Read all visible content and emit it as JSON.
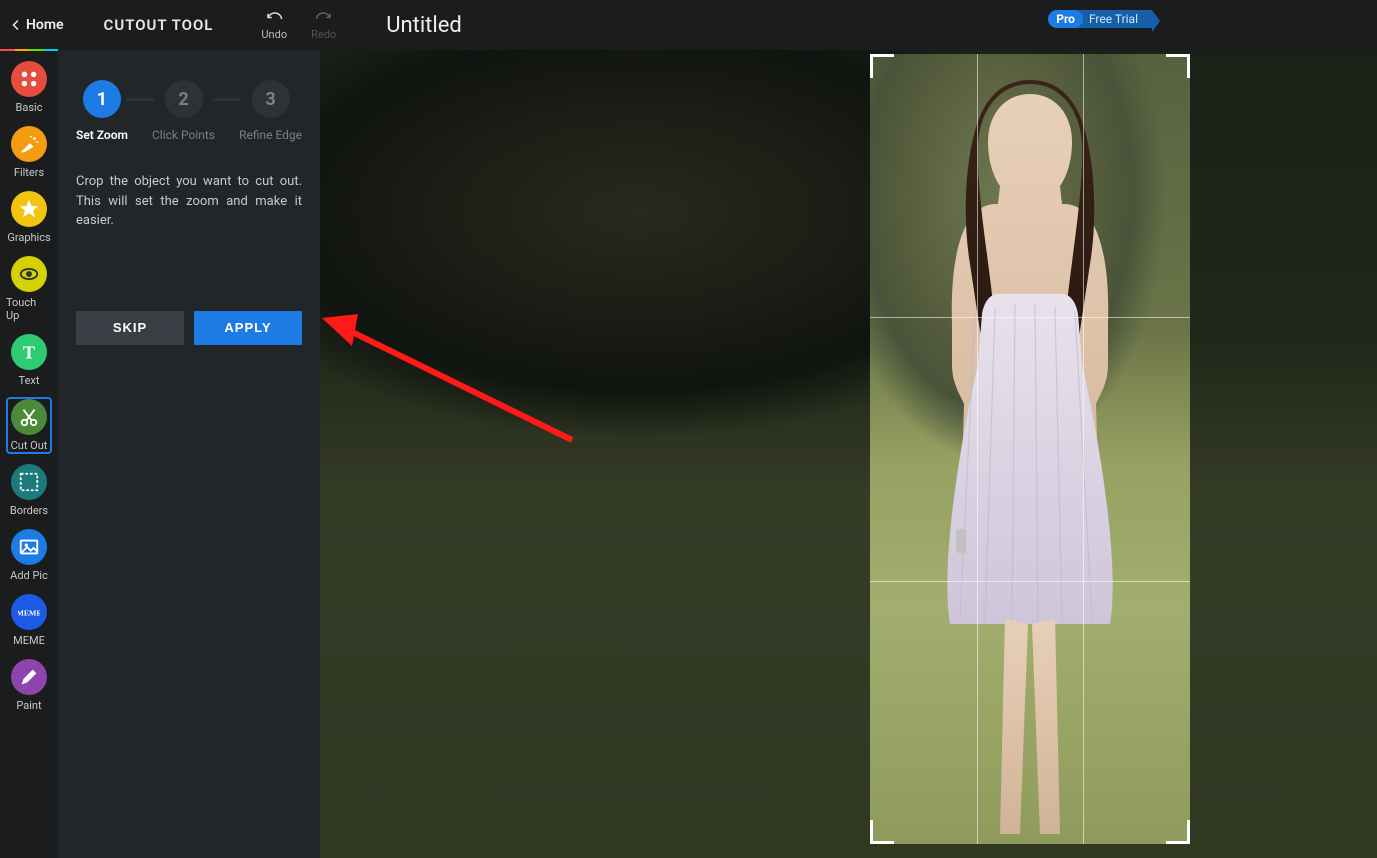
{
  "header": {
    "home": "Home",
    "panel_title": "CUTOUT TOOL",
    "undo": "Undo",
    "redo": "Redo",
    "doc_title": "Untitled",
    "pro_label": "Pro",
    "trial_label": "Free Trial"
  },
  "sidebar": {
    "items": [
      {
        "label": "Basic",
        "color": "#e74c3c"
      },
      {
        "label": "Filters",
        "color": "#f39c12"
      },
      {
        "label": "Graphics",
        "color": "#f1c40f"
      },
      {
        "label": "Touch Up",
        "color": "#d4d200"
      },
      {
        "label": "Text",
        "color": "#2ecc71"
      },
      {
        "label": "Cut Out",
        "color": "#4a8a3a"
      },
      {
        "label": "Borders",
        "color": "#1d7a7a"
      },
      {
        "label": "Add Pic",
        "color": "#1d7be6"
      },
      {
        "label": "MEME",
        "color": "#1d5be6"
      },
      {
        "label": "Paint",
        "color": "#8e44ad"
      }
    ]
  },
  "panel": {
    "steps": [
      {
        "num": "1",
        "label": "Set Zoom"
      },
      {
        "num": "2",
        "label": "Click Points"
      },
      {
        "num": "3",
        "label": "Refine Edge"
      }
    ],
    "text": "Crop the object you want to cut out. This will set the zoom and make it easier.",
    "skip": "SKIP",
    "apply": "APPLY"
  },
  "rainbow": [
    "#ff4a4a",
    "#ffa500",
    "#6bd900",
    "#00cfe0"
  ]
}
